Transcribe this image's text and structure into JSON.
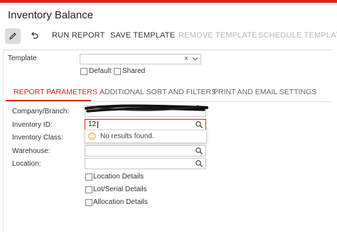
{
  "title": "Inventory Balance",
  "colors": {
    "accent": "#e2231a",
    "disabled": "#b8b8b8"
  },
  "toolbar": {
    "edit_icon": "pencil-icon",
    "undo_icon": "undo-icon",
    "run_report": "RUN REPORT",
    "save_template": "SAVE TEMPLATE",
    "remove_template": "REMOVE TEMPLATE",
    "schedule_template": "SCHEDULE TEMPLATE"
  },
  "template": {
    "label": "Template",
    "value": "",
    "clear_icon": "×",
    "dropdown_icon": "chevron-down-icon",
    "default_label": "Default",
    "shared_label": "Shared"
  },
  "tabs": [
    {
      "label": "REPORT PARAMETERS",
      "active": true
    },
    {
      "label": "ADDITIONAL SORT AND FILTERS",
      "active": false
    },
    {
      "label": "PRINT AND EMAIL SETTINGS",
      "active": false
    }
  ],
  "params": {
    "company_branch": {
      "label": "Company/Branch:",
      "value": ""
    },
    "inventory_id": {
      "label": "Inventory ID:",
      "value": "12"
    },
    "inventory_class": {
      "label": "Inventory Class:",
      "value": ""
    },
    "warehouse": {
      "label": "Warehouse:",
      "value": ""
    },
    "location": {
      "label": "Location:",
      "value": ""
    }
  },
  "lookup_dropdown": {
    "message": "No results found.",
    "icon": "sad-face-icon"
  },
  "checkboxes": [
    {
      "label": "Location Details",
      "checked": false
    },
    {
      "label": "Lot/Serial Details",
      "checked": false
    },
    {
      "label": "Allocation Details",
      "checked": false
    }
  ]
}
